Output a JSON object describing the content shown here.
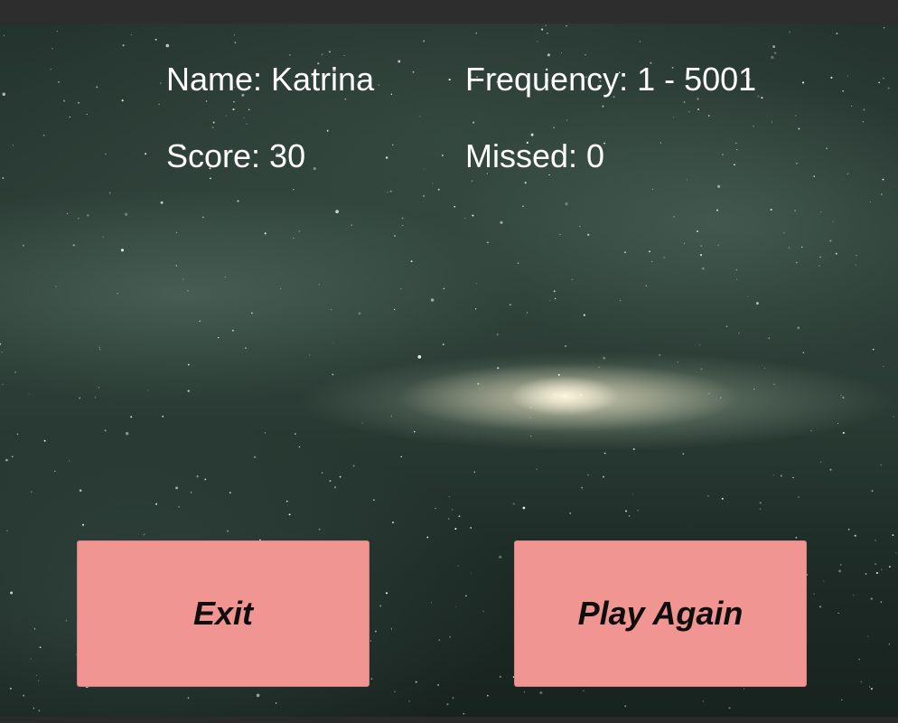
{
  "hud": {
    "name": "Name: Katrina",
    "frequency": "Frequency: 1 - 5001",
    "score": "Score: 30",
    "missed": "Missed: 0"
  },
  "buttons": {
    "exit_label": "Exit",
    "play_again_label": "Play Again"
  },
  "colors": {
    "button_fill": "#f09592",
    "text": "#ffffff",
    "button_text": "#0e0e0e"
  },
  "background": {
    "scene": "galaxy-space-background"
  }
}
